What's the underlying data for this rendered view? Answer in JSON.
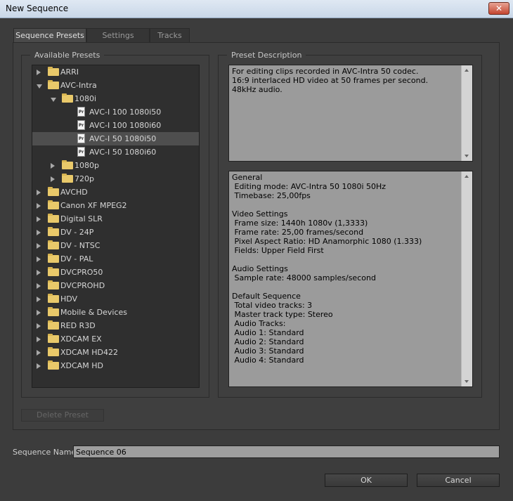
{
  "window": {
    "title": "New Sequence",
    "close_glyph": "✕"
  },
  "tabs": [
    {
      "label": "Sequence Presets",
      "active": true
    },
    {
      "label": "Settings",
      "active": false
    },
    {
      "label": "Tracks",
      "active": false
    }
  ],
  "presets": {
    "group_label": "Available Presets",
    "tree": [
      {
        "label": "ARRI",
        "type": "folder",
        "depth": 0,
        "expanded": false,
        "selected": false
      },
      {
        "label": "AVC-Intra",
        "type": "folder",
        "depth": 0,
        "expanded": true,
        "selected": false
      },
      {
        "label": "1080i",
        "type": "folder",
        "depth": 1,
        "expanded": true,
        "selected": false
      },
      {
        "label": "AVC-I 100 1080i50",
        "type": "preset",
        "depth": 2,
        "selected": false
      },
      {
        "label": "AVC-I 100 1080i60",
        "type": "preset",
        "depth": 2,
        "selected": false
      },
      {
        "label": "AVC-I 50 1080i50",
        "type": "preset",
        "depth": 2,
        "selected": true
      },
      {
        "label": "AVC-I 50 1080i60",
        "type": "preset",
        "depth": 2,
        "selected": false
      },
      {
        "label": "1080p",
        "type": "folder",
        "depth": 1,
        "expanded": false,
        "selected": false
      },
      {
        "label": "720p",
        "type": "folder",
        "depth": 1,
        "expanded": false,
        "selected": false
      },
      {
        "label": "AVCHD",
        "type": "folder",
        "depth": 0,
        "expanded": false,
        "selected": false
      },
      {
        "label": "Canon XF MPEG2",
        "type": "folder",
        "depth": 0,
        "expanded": false,
        "selected": false
      },
      {
        "label": "Digital SLR",
        "type": "folder",
        "depth": 0,
        "expanded": false,
        "selected": false
      },
      {
        "label": "DV - 24P",
        "type": "folder",
        "depth": 0,
        "expanded": false,
        "selected": false
      },
      {
        "label": "DV - NTSC",
        "type": "folder",
        "depth": 0,
        "expanded": false,
        "selected": false
      },
      {
        "label": "DV - PAL",
        "type": "folder",
        "depth": 0,
        "expanded": false,
        "selected": false
      },
      {
        "label": "DVCPRO50",
        "type": "folder",
        "depth": 0,
        "expanded": false,
        "selected": false
      },
      {
        "label": "DVCPROHD",
        "type": "folder",
        "depth": 0,
        "expanded": false,
        "selected": false
      },
      {
        "label": "HDV",
        "type": "folder",
        "depth": 0,
        "expanded": false,
        "selected": false
      },
      {
        "label": "Mobile & Devices",
        "type": "folder",
        "depth": 0,
        "expanded": false,
        "selected": false
      },
      {
        "label": "RED R3D",
        "type": "folder",
        "depth": 0,
        "expanded": false,
        "selected": false
      },
      {
        "label": "XDCAM EX",
        "type": "folder",
        "depth": 0,
        "expanded": false,
        "selected": false
      },
      {
        "label": "XDCAM HD422",
        "type": "folder",
        "depth": 0,
        "expanded": false,
        "selected": false
      },
      {
        "label": "XDCAM HD",
        "type": "folder",
        "depth": 0,
        "expanded": false,
        "selected": false
      }
    ],
    "delete_button": "Delete Preset"
  },
  "description": {
    "group_label": "Preset Description",
    "summary": "For editing clips recorded in AVC-Intra 50 codec.\n16:9 interlaced HD video at 50 frames per second.\n48kHz audio.",
    "details": "General\n Editing mode: AVC-Intra 50 1080i 50Hz\n Timebase: 25,00fps\n\nVideo Settings\n Frame size: 1440h 1080v (1,3333)\n Frame rate: 25,00 frames/second\n Pixel Aspect Ratio: HD Anamorphic 1080 (1.333)\n Fields: Upper Field First\n\nAudio Settings\n Sample rate: 48000 samples/second\n\nDefault Sequence\n Total video tracks: 3\n Master track type: Stereo\n Audio Tracks:\n Audio 1: Standard\n Audio 2: Standard\n Audio 3: Standard\n Audio 4: Standard"
  },
  "sequence_name": {
    "label": "Sequence Name:",
    "value": "Sequence 06"
  },
  "footer": {
    "ok_label": "OK",
    "cancel_label": "Cancel"
  },
  "pr_icon_text": "Pr"
}
